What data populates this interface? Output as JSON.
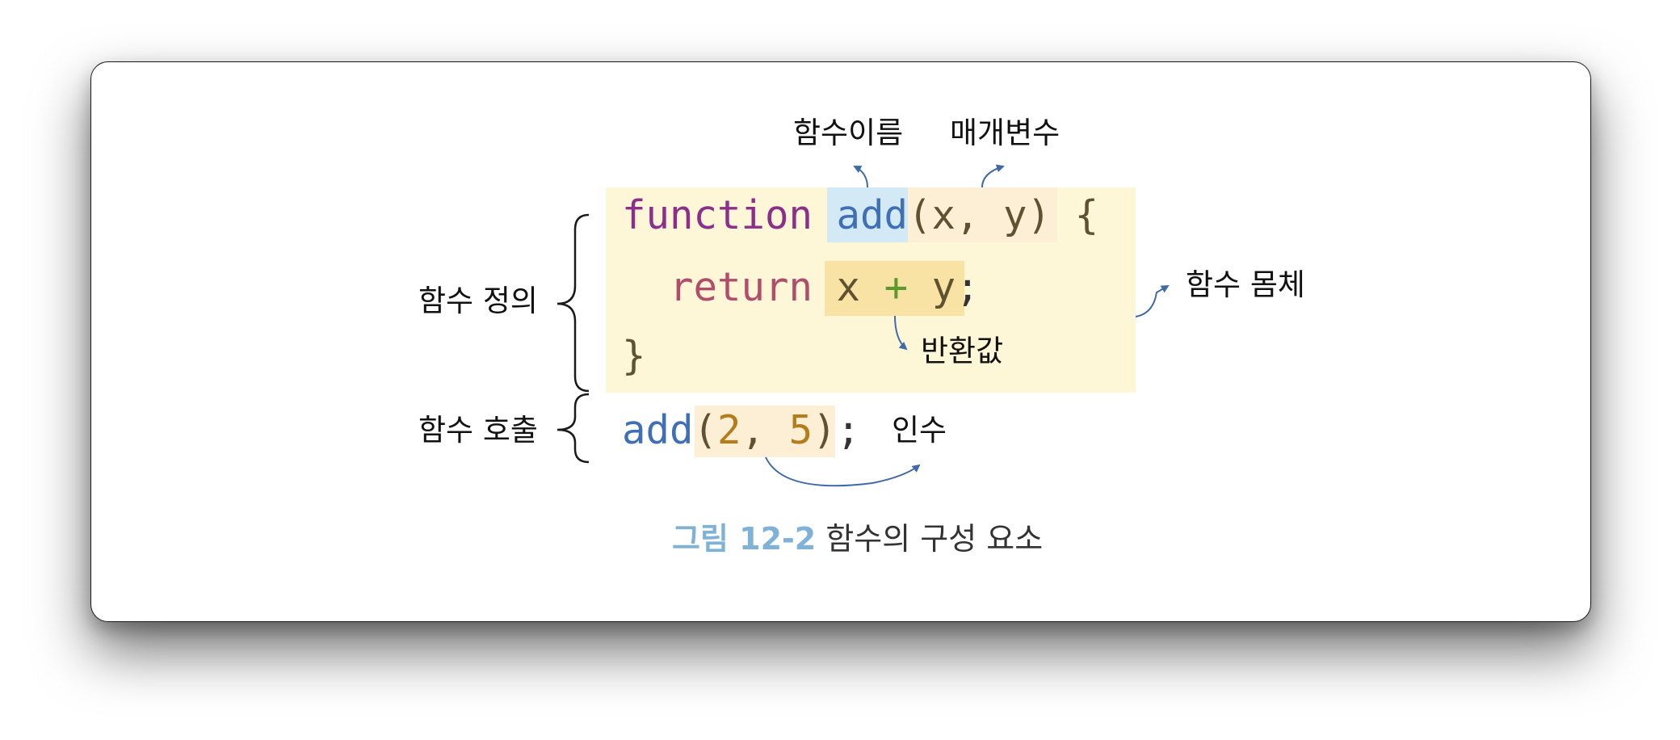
{
  "labels": {
    "function_name": "함수이름",
    "parameters": "매개변수",
    "function_definition": "함수 정의",
    "function_body": "함수 몸체",
    "return_value": "반환값",
    "function_call": "함수 호출",
    "arguments": "인수"
  },
  "code": {
    "line1": {
      "keyword": "function",
      "name": "add",
      "params": "(x, y)",
      "brace": "{"
    },
    "line2": {
      "keyword": "return",
      "expr_x": "x",
      "expr_plus": "+",
      "expr_y": "y",
      "semicolon": ";"
    },
    "line3": {
      "brace": "}"
    },
    "call": {
      "name": "add",
      "open": "(",
      "arg1": "2",
      "comma": ",",
      "arg2": "5",
      "close": ")",
      "semicolon": ";"
    }
  },
  "caption": {
    "prefix": "그림 12-2",
    "text": "함수의 구성 요소"
  },
  "colors": {
    "body_highlight": "#fdf7d8",
    "name_highlight": "#d3e9f5",
    "param_highlight": "#fdeed6",
    "expr_highlight": "#f8e2a4",
    "arrow": "#4169a8",
    "caption_prefix": "#7fb2d5"
  }
}
